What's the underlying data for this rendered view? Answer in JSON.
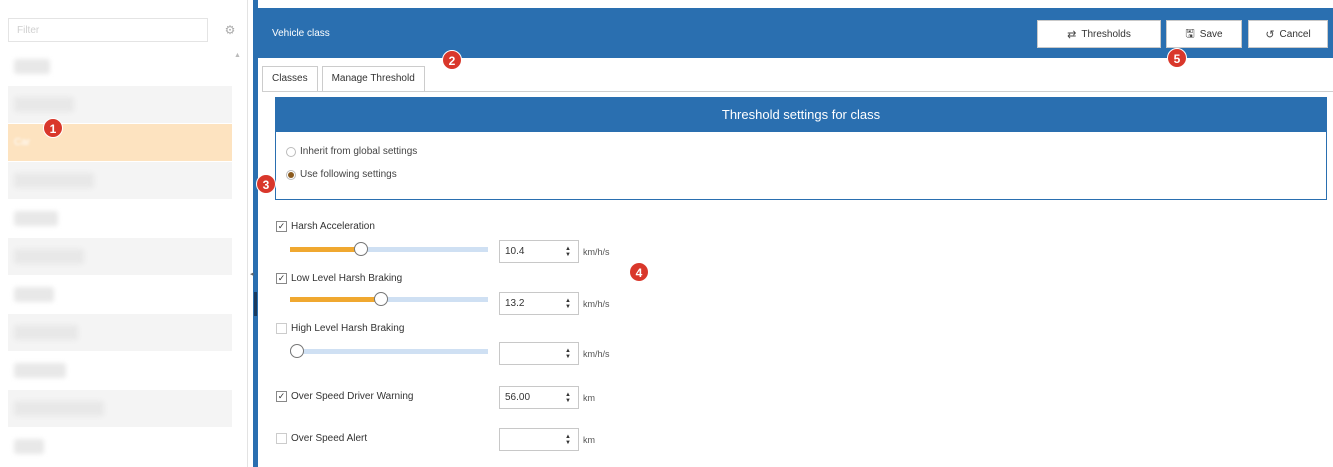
{
  "sidebar": {
    "filter_placeholder": "Filter",
    "selected_label": "Car"
  },
  "header": {
    "title": "Vehicle class",
    "thresholds_label": "Thresholds",
    "save_label": "Save",
    "cancel_label": "Cancel"
  },
  "tabs": [
    {
      "label": "Classes",
      "active": false
    },
    {
      "label": "Manage Threshold",
      "active": true
    }
  ],
  "threshold_box": {
    "title": "Threshold settings for class",
    "options": [
      {
        "label": "Inherit from global settings",
        "selected": false
      },
      {
        "label": "Use following settings",
        "selected": true
      }
    ]
  },
  "settings": [
    {
      "label": "Harsh Acceleration",
      "checked": true,
      "value": "10.4",
      "unit": "km/h/s",
      "slider_level": 0.36
    },
    {
      "label": "Low Level Harsh Braking",
      "checked": true,
      "value": "13.2",
      "unit": "km/h/s",
      "slider_level": 0.46
    },
    {
      "label": "High Level Harsh Braking",
      "checked": false,
      "value": "",
      "unit": "km/h/s",
      "slider_level": 0.0
    },
    {
      "label": "Over Speed Driver Warning",
      "checked": true,
      "value": "56.00",
      "unit": "km"
    },
    {
      "label": "Over Speed Alert",
      "checked": false,
      "value": "",
      "unit": "km"
    }
  ],
  "badges": [
    "1",
    "2",
    "3",
    "4",
    "5"
  ],
  "colors": {
    "primary": "#2a6fb0",
    "selection": "#fde3c0",
    "slider_fill": "#f0a830",
    "badge": "#d9372b"
  }
}
